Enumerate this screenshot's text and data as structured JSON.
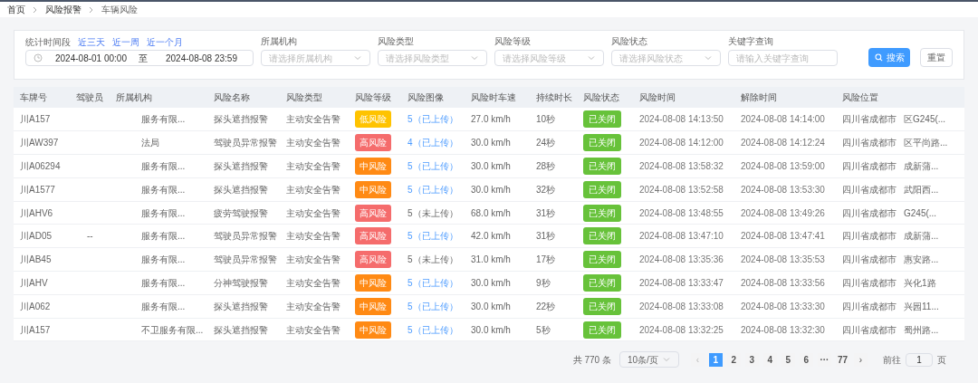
{
  "breadcrumb": [
    "首页",
    "风险报警",
    "车辆风险"
  ],
  "filters": {
    "period_label": "统计时间段",
    "quick_ranges": [
      "近三天",
      "近一周",
      "近一个月"
    ],
    "start": "2024-08-01 00:00",
    "separator": "至",
    "end": "2024-08-08 23:59",
    "selects": [
      {
        "label": "所属机构",
        "placeholder": "请选择所属机构"
      },
      {
        "label": "风险类型",
        "placeholder": "请选择风险类型"
      },
      {
        "label": "风险等级",
        "placeholder": "请选择风险等级"
      },
      {
        "label": "风险状态",
        "placeholder": "请选择风险状态"
      }
    ],
    "keyword": {
      "label": "关键字查询",
      "placeholder": "请输入关键字查询"
    },
    "search_button": "搜索",
    "reset_button": "重置"
  },
  "table": {
    "columns": [
      "车牌号",
      "驾驶员",
      "所属机构",
      "风险名称",
      "风险类型",
      "风险等级",
      "风险图像",
      "风险时车速",
      "持续时长",
      "风险状态",
      "风险时间",
      "解除时间",
      "风险位置"
    ],
    "rows": [
      {
        "plate": "川A157",
        "driver": "",
        "org": "服务有限...",
        "name": "探头遮挡报警",
        "type": "主动安全告警",
        "level": {
          "text": "低风险",
          "kind": "low"
        },
        "image": {
          "text": "5（已上传）",
          "uploaded": true
        },
        "speed": "27.0 km/h",
        "duration": "10秒",
        "status": "已关闭",
        "risk_time": "2024-08-08 14:13:50",
        "clear_time": "2024-08-08 14:14:00",
        "location": "四川省成都市",
        "location_tail": "区G245(..."
      },
      {
        "plate": "川AW397",
        "driver": "",
        "org": "法局",
        "name": "驾驶员异常报警",
        "type": "主动安全告警",
        "level": {
          "text": "高风险",
          "kind": "high"
        },
        "image": {
          "text": "4（已上传）",
          "uploaded": true
        },
        "speed": "30.0 km/h",
        "duration": "24秒",
        "status": "已关闭",
        "risk_time": "2024-08-08 14:12:00",
        "clear_time": "2024-08-08 14:12:24",
        "location": "四川省成都市",
        "location_tail": "区平尚路..."
      },
      {
        "plate": "川A06294",
        "driver": "",
        "org": "服务有限...",
        "name": "探头遮挡报警",
        "type": "主动安全告警",
        "level": {
          "text": "中风险",
          "kind": "medium"
        },
        "image": {
          "text": "5（已上传）",
          "uploaded": true
        },
        "speed": "30.0 km/h",
        "duration": "28秒",
        "status": "已关闭",
        "risk_time": "2024-08-08 13:58:32",
        "clear_time": "2024-08-08 13:59:00",
        "location": "四川省成都市",
        "location_tail": "成新蒲..."
      },
      {
        "plate": "川A1577",
        "driver": "",
        "org": "服务有限...",
        "name": "探头遮挡报警",
        "type": "主动安全告警",
        "level": {
          "text": "中风险",
          "kind": "medium"
        },
        "image": {
          "text": "5（已上传）",
          "uploaded": true
        },
        "speed": "30.0 km/h",
        "duration": "32秒",
        "status": "已关闭",
        "risk_time": "2024-08-08 13:52:58",
        "clear_time": "2024-08-08 13:53:30",
        "location": "四川省成都市",
        "location_tail": "武阳西..."
      },
      {
        "plate": "川AHV6",
        "driver": "",
        "org": "服务有限...",
        "name": "疲劳驾驶报警",
        "type": "主动安全告警",
        "level": {
          "text": "高风险",
          "kind": "high"
        },
        "image": {
          "text": "5（未上传）",
          "uploaded": false
        },
        "speed": "68.0 km/h",
        "duration": "31秒",
        "status": "已关闭",
        "risk_time": "2024-08-08 13:48:55",
        "clear_time": "2024-08-08 13:49:26",
        "location": "四川省成都市",
        "location_tail": "G245(..."
      },
      {
        "plate": "川AD05",
        "driver": "--",
        "org": "服务有限...",
        "name": "驾驶员异常报警",
        "type": "主动安全告警",
        "level": {
          "text": "高风险",
          "kind": "high"
        },
        "image": {
          "text": "5（已上传）",
          "uploaded": true
        },
        "speed": "42.0 km/h",
        "duration": "31秒",
        "status": "已关闭",
        "risk_time": "2024-08-08 13:47:10",
        "clear_time": "2024-08-08 13:47:41",
        "location": "四川省成都市",
        "location_tail": "成新蒲..."
      },
      {
        "plate": "川AB45",
        "driver": "",
        "org": "服务有限...",
        "name": "驾驶员异常报警",
        "type": "主动安全告警",
        "level": {
          "text": "高风险",
          "kind": "high"
        },
        "image": {
          "text": "5（未上传）",
          "uploaded": false
        },
        "speed": "31.0 km/h",
        "duration": "17秒",
        "status": "已关闭",
        "risk_time": "2024-08-08 13:35:36",
        "clear_time": "2024-08-08 13:35:53",
        "location": "四川省成都市",
        "location_tail": "惠安路..."
      },
      {
        "plate": "川AHV",
        "driver": "",
        "org": "服务有限...",
        "name": "分神驾驶报警",
        "type": "主动安全告警",
        "level": {
          "text": "中风险",
          "kind": "medium"
        },
        "image": {
          "text": "5（已上传）",
          "uploaded": true
        },
        "speed": "30.0 km/h",
        "duration": "9秒",
        "status": "已关闭",
        "risk_time": "2024-08-08 13:33:47",
        "clear_time": "2024-08-08 13:33:56",
        "location": "四川省成都市",
        "location_tail": "兴化1路"
      },
      {
        "plate": "川A062",
        "driver": "",
        "org": "服务有限...",
        "name": "探头遮挡报警",
        "type": "主动安全告警",
        "level": {
          "text": "中风险",
          "kind": "medium"
        },
        "image": {
          "text": "5（已上传）",
          "uploaded": true
        },
        "speed": "30.0 km/h",
        "duration": "22秒",
        "status": "已关闭",
        "risk_time": "2024-08-08 13:33:08",
        "clear_time": "2024-08-08 13:33:30",
        "location": "四川省成都市",
        "location_tail": "兴园11..."
      },
      {
        "plate": "川A157",
        "driver": "",
        "org": "不卫服务有限...",
        "name": "探头遮挡报警",
        "type": "主动安全告警",
        "level": {
          "text": "中风险",
          "kind": "medium"
        },
        "image": {
          "text": "5（已上传）",
          "uploaded": true
        },
        "speed": "30.0 km/h",
        "duration": "5秒",
        "status": "已关闭",
        "risk_time": "2024-08-08 13:32:25",
        "clear_time": "2024-08-08 13:32:30",
        "location": "四川省成都市",
        "location_tail": "蜀州路..."
      }
    ]
  },
  "pagination": {
    "total": "共 770 条",
    "page_size": "10条/页",
    "prev": "‹",
    "pages": [
      {
        "label": "1",
        "selected": true
      },
      {
        "label": "2",
        "selected": false
      },
      {
        "label": "3",
        "selected": false
      },
      {
        "label": "4",
        "selected": false
      },
      {
        "label": "5",
        "selected": false
      },
      {
        "label": "6",
        "selected": false
      },
      {
        "label": "···",
        "selected": false
      },
      {
        "label": "77",
        "selected": false
      }
    ],
    "next": "›",
    "goto_label": "前往",
    "goto_value": "1",
    "goto_unit": "页"
  }
}
